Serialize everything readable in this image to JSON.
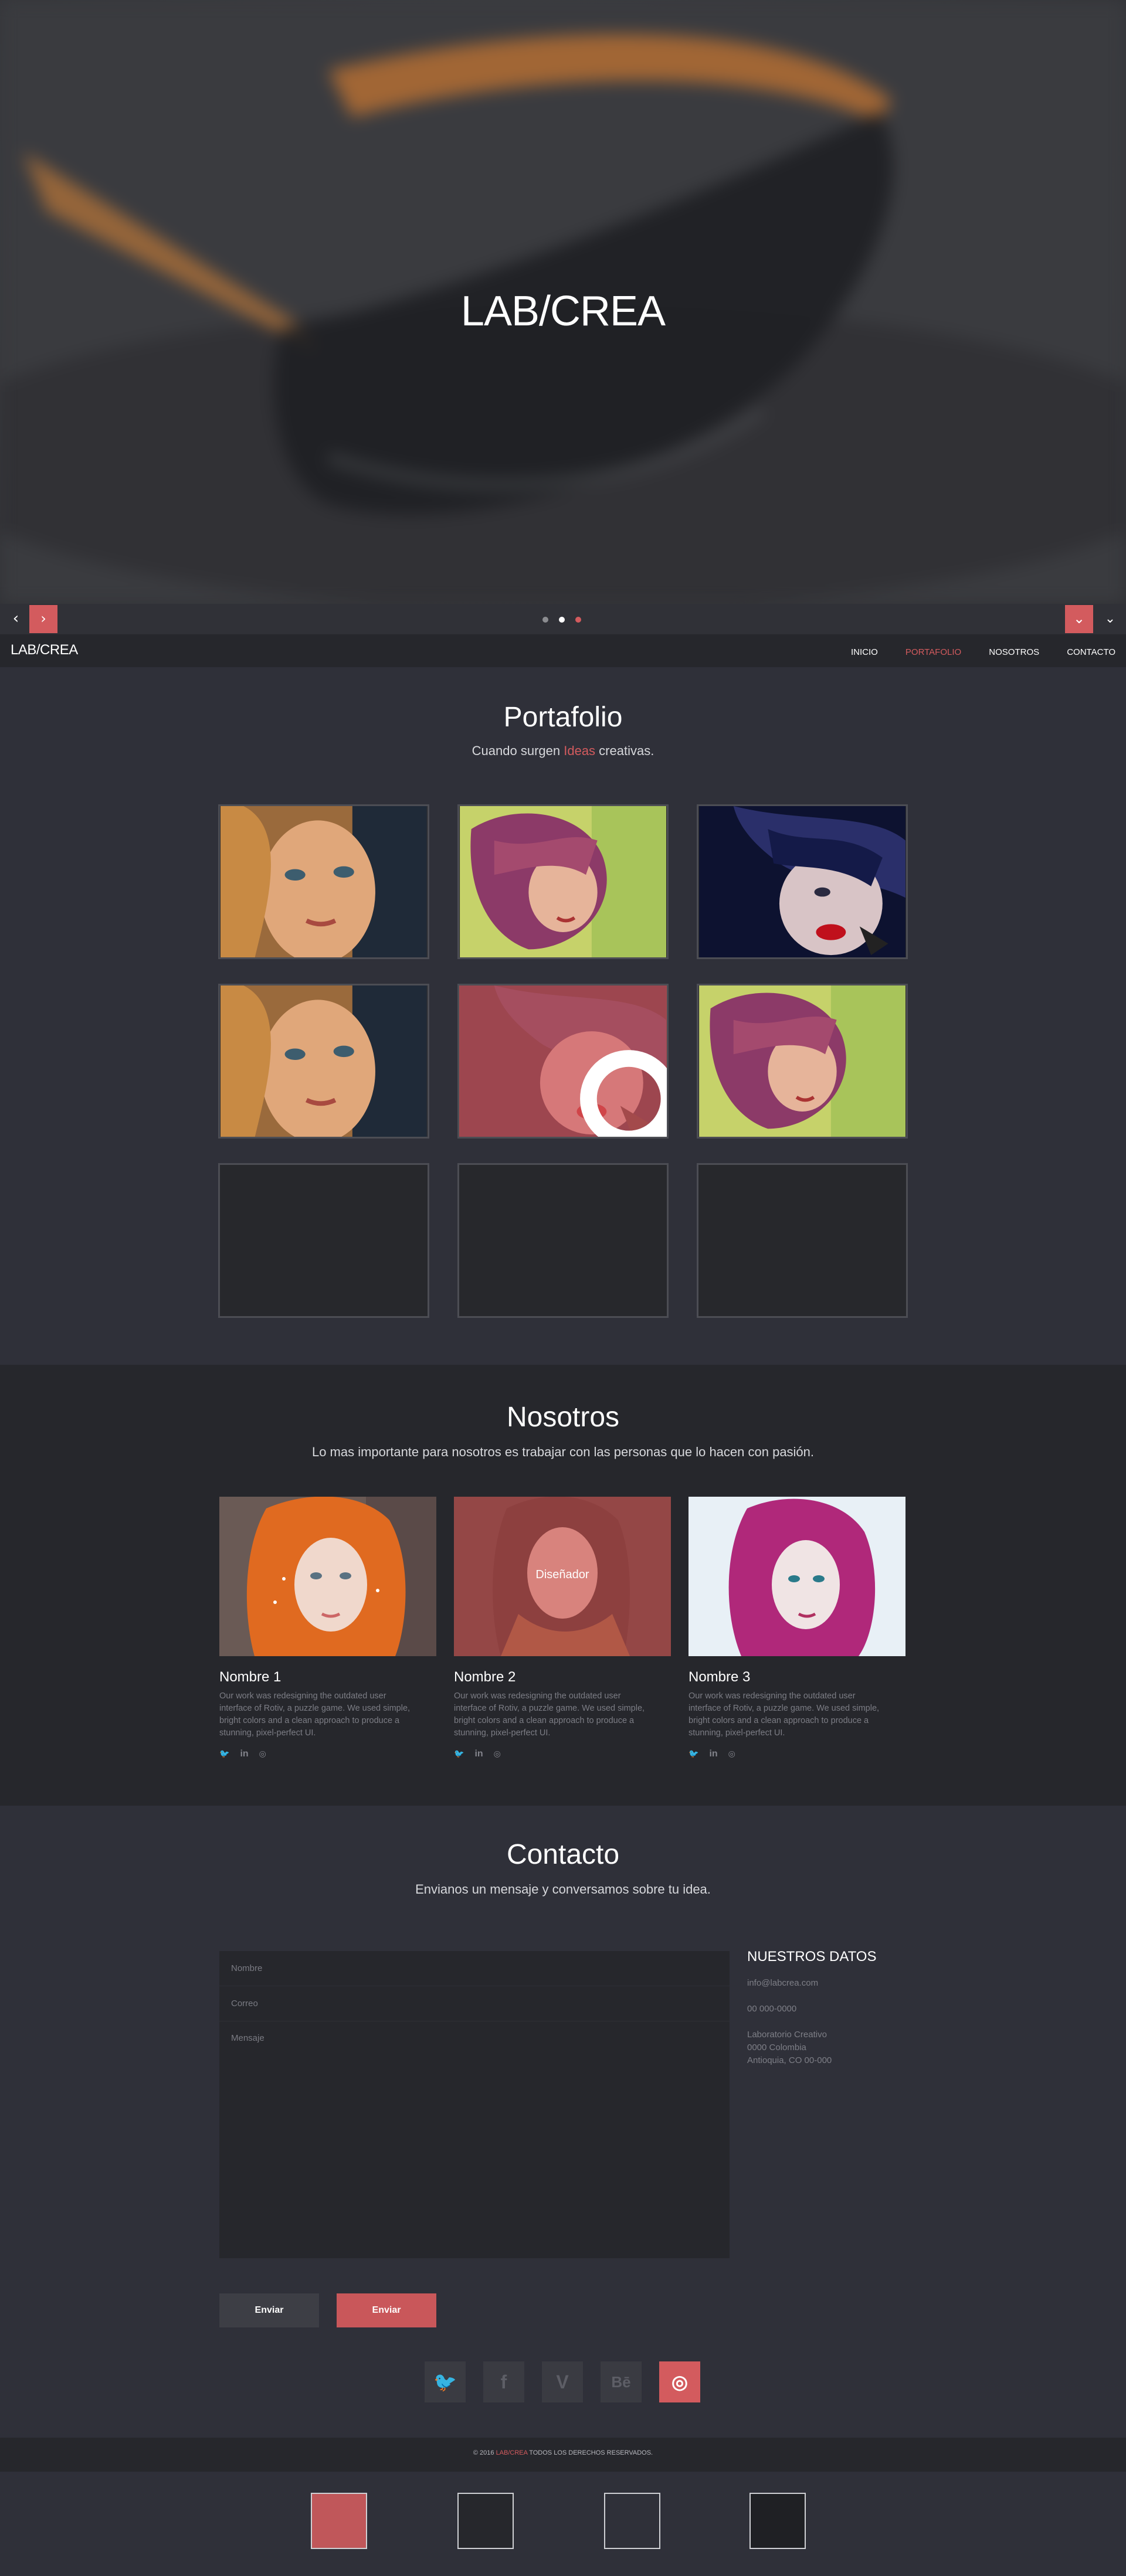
{
  "hero": {
    "title": "LAB/CREA"
  },
  "slider": {
    "prev_label": "‹",
    "next_label": "›",
    "down_label": "⌄",
    "down_label_right": "⌄",
    "slides_count": 3,
    "active_slide": 2
  },
  "nav": {
    "brand": "LAB/CREA",
    "items": [
      {
        "label": "INICIO",
        "active": false
      },
      {
        "label": "PORTAFOLIO",
        "active": true
      },
      {
        "label": "NOSOTROS",
        "active": false
      },
      {
        "label": "CONTACTO",
        "active": false
      }
    ]
  },
  "portfolio": {
    "title": "Portafolio",
    "subtitle_pre": "Cuando surgen ",
    "subtitle_accent": "Ideas",
    "subtitle_post": " creativas."
  },
  "nosotros": {
    "title": "Nosotros",
    "subtitle": "Lo mas importante para nosotros es trabajar con las personas que lo hacen con pasión.",
    "members": [
      {
        "name": "Nombre 1",
        "role": "",
        "description": "Our work was redesigning the outdated user interface of Rotiv, a puzzle game. We used simple, bright colors and a clean approach to produce a stunning, pixel-perfect UI."
      },
      {
        "name": "Nombre 2",
        "role": "Diseñador",
        "description": "Our work was redesigning the outdated user interface of Rotiv, a puzzle game. We used simple, bright colors and a clean approach to produce a stunning, pixel-perfect UI."
      },
      {
        "name": "Nombre 3",
        "role": "",
        "description": "Our work was redesigning the outdated user interface of Rotiv, a puzzle game. We used simple, bright colors and a clean approach to produce a stunning, pixel-perfect UI."
      }
    ]
  },
  "contacto": {
    "title": "Contacto",
    "subtitle": "Envianos un mensaje y conversamos sobre tu idea.",
    "form": {
      "name_placeholder": "Nombre",
      "email_placeholder": "Correo",
      "message_placeholder": "Mensaje",
      "button_secondary": "Enviar",
      "button_primary": "Enviar"
    },
    "datos": {
      "title": "NUESTROS DATOS",
      "email": "info@labcrea.com",
      "phone": "00 000-0000",
      "address_1": "Laboratorio Creativo",
      "address_2": "0000 Colombia",
      "address_3": "Antioquia, CO 00-000"
    },
    "social": [
      {
        "icon": "twitter-icon",
        "glyph": "🐦"
      },
      {
        "icon": "facebook-icon",
        "glyph": "f"
      },
      {
        "icon": "vimeo-icon",
        "glyph": "V"
      },
      {
        "icon": "behance-icon",
        "glyph": "Bē"
      },
      {
        "icon": "dribbble-icon",
        "glyph": "◎"
      }
    ]
  },
  "footer": {
    "prefix": "© 2016 ",
    "brand": "LAB/CREA",
    "suffix": " TODOS LOS DERECHOS RESERVADOS."
  },
  "colors": {
    "accent": "#d35b5e",
    "background": "#2f3039",
    "dark_band": "#26272c"
  }
}
